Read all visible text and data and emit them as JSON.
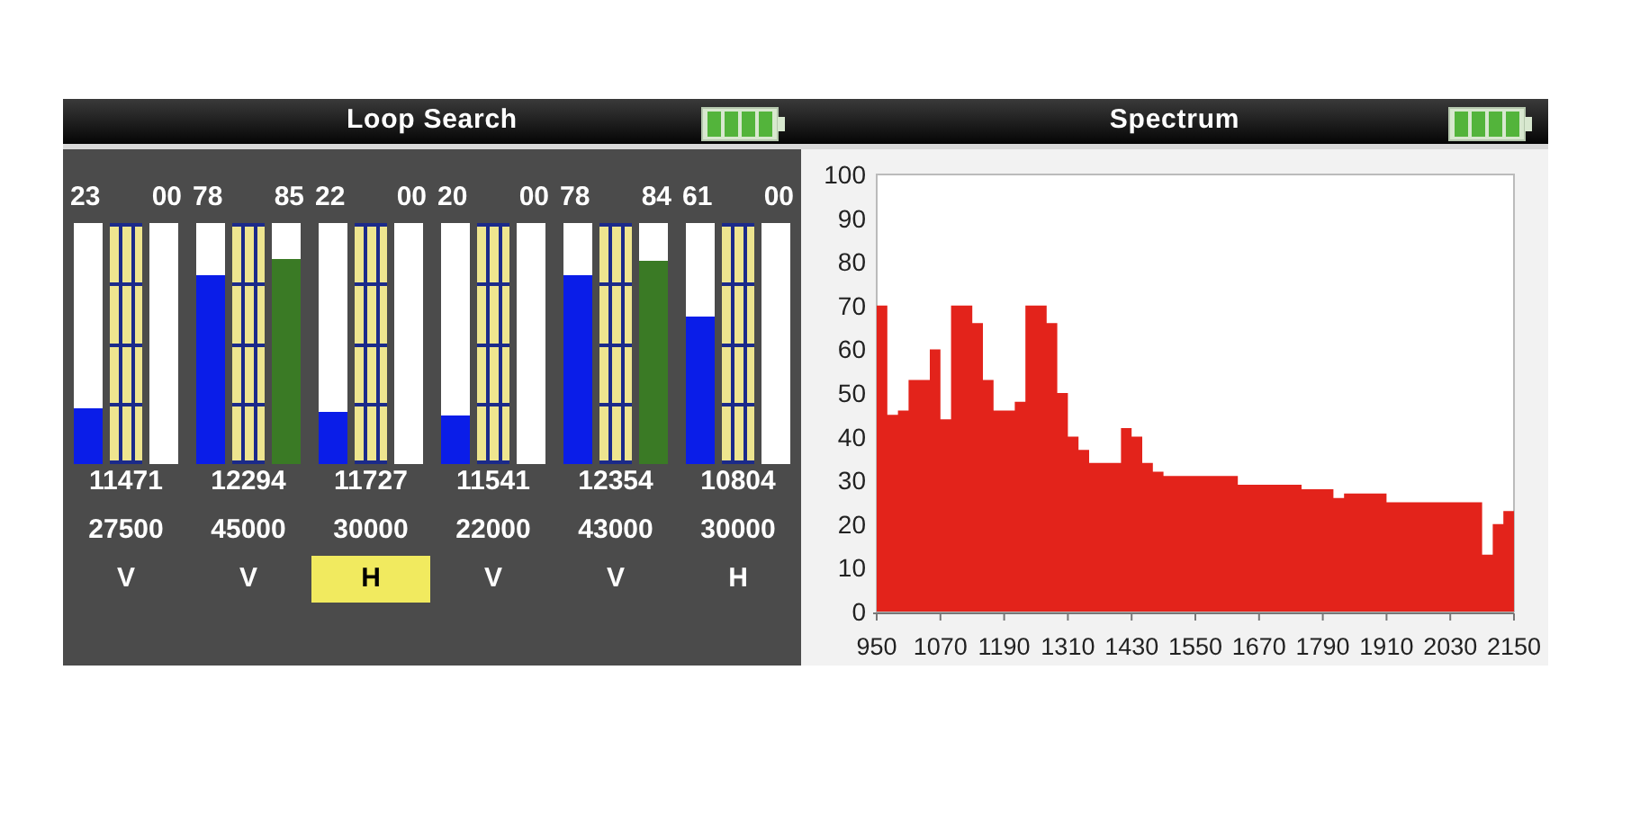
{
  "loop_search": {
    "title": "Loop Search",
    "channels": [
      {
        "signal": {
          "reading": "23",
          "level": 0.23
        },
        "quality": {
          "reading": "00"
        },
        "frequency": "11471",
        "symbol_rate": "27500",
        "polarization": "V",
        "selected": false
      },
      {
        "signal": {
          "reading": "78",
          "level": 0.78
        },
        "quality": {
          "reading": "85",
          "level": 0.85
        },
        "frequency": "12294",
        "symbol_rate": "45000",
        "polarization": "V",
        "selected": false
      },
      {
        "signal": {
          "reading": "22",
          "level": 0.22
        },
        "quality": {
          "reading": "00"
        },
        "frequency": "11727",
        "symbol_rate": "30000",
        "polarization": "H",
        "selected": true
      },
      {
        "signal": {
          "reading": "20",
          "level": 0.2
        },
        "quality": {
          "reading": "00"
        },
        "frequency": "11541",
        "symbol_rate": "22000",
        "polarization": "V",
        "selected": false
      },
      {
        "signal": {
          "reading": "78",
          "level": 0.78
        },
        "quality": {
          "reading": "84",
          "level": 0.84
        },
        "frequency": "12354",
        "symbol_rate": "43000",
        "polarization": "V",
        "selected": false
      },
      {
        "signal": {
          "reading": "61",
          "level": 0.61
        },
        "quality": {
          "reading": "00"
        },
        "frequency": "10804",
        "symbol_rate": "30000",
        "polarization": "H",
        "selected": false
      }
    ]
  },
  "spectrum": {
    "title": "Spectrum",
    "chart_data": {
      "type": "area",
      "x": [
        950,
        970,
        990,
        1010,
        1030,
        1050,
        1070,
        1090,
        1110,
        1130,
        1150,
        1170,
        1190,
        1210,
        1230,
        1250,
        1270,
        1290,
        1310,
        1330,
        1350,
        1370,
        1390,
        1410,
        1430,
        1450,
        1470,
        1490,
        1510,
        1530,
        1550,
        1570,
        1590,
        1610,
        1630,
        1650,
        1670,
        1690,
        1710,
        1730,
        1750,
        1770,
        1790,
        1810,
        1830,
        1850,
        1870,
        1890,
        1910,
        1930,
        1950,
        1970,
        1990,
        2010,
        2030,
        2050,
        2070,
        2090,
        2110,
        2130,
        2150
      ],
      "series": [
        {
          "color": "#e3231b",
          "values": [
            70,
            45,
            46,
            53,
            53,
            60,
            44,
            70,
            70,
            66,
            53,
            46,
            46,
            48,
            70,
            70,
            66,
            50,
            40,
            37,
            34,
            34,
            34,
            42,
            40,
            34,
            32,
            31,
            31,
            31,
            31,
            31,
            31,
            31,
            29,
            29,
            29,
            29,
            29,
            29,
            28,
            28,
            28,
            26,
            27,
            27,
            27,
            27,
            25,
            25,
            25,
            25,
            25,
            25,
            25,
            25,
            25,
            13,
            20,
            23,
            23
          ]
        }
      ],
      "xlim": [
        950,
        2150
      ],
      "ylim": [
        0,
        100
      ],
      "xticks": [
        950,
        1070,
        1190,
        1310,
        1430,
        1550,
        1670,
        1790,
        1910,
        2030,
        2150
      ],
      "yticks": [
        0,
        10,
        20,
        30,
        40,
        50,
        60,
        70,
        80,
        90,
        100
      ]
    }
  }
}
